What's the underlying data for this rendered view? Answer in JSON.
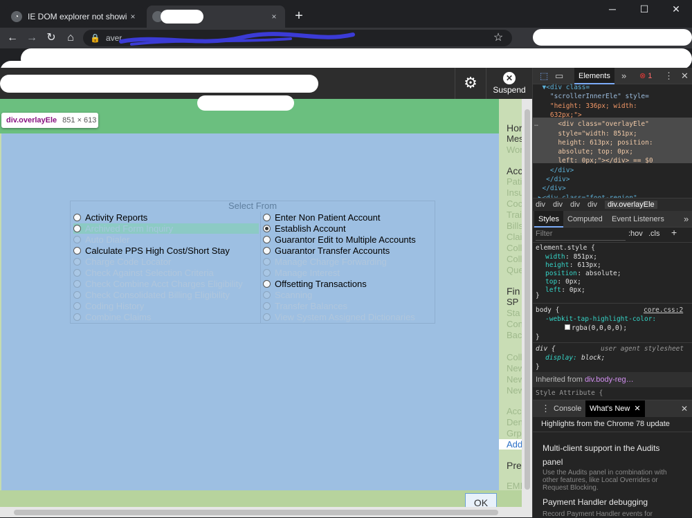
{
  "browser": {
    "tabs": [
      {
        "title": "IE DOM explorer not showing the",
        "close": "×"
      },
      {
        "title": "",
        "close": "×"
      }
    ],
    "new_tab": "+",
    "window_controls": [
      "─",
      "☐",
      "✕"
    ],
    "nav": {
      "back": "←",
      "forward": "→",
      "reload": "↻",
      "home": "⌂",
      "star": "☆"
    },
    "address": "aver..."
  },
  "app": {
    "settings_icon": "⚙",
    "suspend_label": "Suspend",
    "suspend_icon": "✕",
    "ok_label": "OK"
  },
  "inspect_tooltip": {
    "tag": "div.overlayEle",
    "dims": "851 × 613"
  },
  "select_from": {
    "title": "Select From",
    "left_options": [
      {
        "label": "Activity Reports",
        "state": "normal"
      },
      {
        "label": "Archived Form Inquiry",
        "state": "highlight"
      },
      {
        "label": "Auto Dialer",
        "state": "dim"
      },
      {
        "label": "Calculate PPS High Cost/Short Stay",
        "state": "normal"
      },
      {
        "label": "Charge Code Locator",
        "state": "dim"
      },
      {
        "label": "Check Against Selection Criteria",
        "state": "dim"
      },
      {
        "label": "Check Combine Acct Charges Eligibility",
        "state": "dim"
      },
      {
        "label": "Check Consolidated Billing Eligibility",
        "state": "dim"
      },
      {
        "label": "Coding History",
        "state": "dim"
      },
      {
        "label": "Combine Claims",
        "state": "dim"
      }
    ],
    "right_options": [
      {
        "label": "Enter Non Patient Account",
        "state": "normal"
      },
      {
        "label": "Establish Account",
        "state": "selected"
      },
      {
        "label": "Guarantor Edit to Multiple Accounts",
        "state": "normal"
      },
      {
        "label": "Guarantor Transfer Accounts",
        "state": "normal"
      },
      {
        "label": "Manage Charge Forwarding",
        "state": "dim"
      },
      {
        "label": "Manage Interest",
        "state": "dim"
      },
      {
        "label": "Offsetting Transactions",
        "state": "normal"
      },
      {
        "label": "Scanning",
        "state": "dim"
      },
      {
        "label": "Transfer Balances",
        "state": "dim"
      },
      {
        "label": "View System Assigned Dictionaries",
        "state": "dim"
      }
    ]
  },
  "right_panel": [
    "Hor",
    "Mes",
    "Wor",
    "Acc",
    "Pati",
    "Insu",
    "Coc",
    "Trai",
    "Bills",
    "Clai",
    "Coll",
    "Coll",
    "Que",
    "Fin",
    "SP",
    "Sta",
    "Con",
    "Bac",
    "Coll",
    "New",
    "New",
    "New",
    "Acc",
    "Den",
    "Grp",
    "Add",
    "Pref",
    "EMI"
  ],
  "devtools": {
    "tabs": {
      "inspect": "⬚",
      "device": "▭",
      "elements": "Elements",
      "more": "»",
      "errors": "1",
      "menu": "⋮",
      "close": "✕"
    },
    "code_lines": [
      {
        "text": "  ▼<div class=",
        "kind": "tag"
      },
      {
        "text": "    \"scrollerInnerEle\" style=",
        "kind": "attr"
      },
      {
        "text": "    \"height: 336px; width:",
        "kind": "val"
      },
      {
        "text": "    632px;\">",
        "kind": "val"
      },
      {
        "text": "      <div class=\"overlayEle\"",
        "kind": "hi"
      },
      {
        "text": "      style=\"width: 851px;",
        "kind": "hi"
      },
      {
        "text": "      height: 613px; position:",
        "kind": "hi"
      },
      {
        "text": "      absolute; top: 0px;",
        "kind": "hi"
      },
      {
        "text": "      left: 0px;\"></div> == $0",
        "kind": "hi"
      },
      {
        "text": "    </div>",
        "kind": "tag"
      },
      {
        "text": "   </div>",
        "kind": "tag"
      },
      {
        "text": "  </div>",
        "kind": "tag"
      },
      {
        "text": " ▶<div class=\"foot-region\"",
        "kind": "tag"
      }
    ],
    "breadcrumbs": [
      "div",
      "div",
      "div",
      "div",
      "div.overlayEle"
    ],
    "style_tabs": [
      "Styles",
      "Computed",
      "Event Listeners",
      "»"
    ],
    "filter_placeholder": "Filter",
    "filter_tools": [
      ":hov",
      ".cls",
      "+"
    ],
    "element_style": {
      "selector": "element.style {",
      "props": [
        {
          "name": "width",
          "value": "851px;"
        },
        {
          "name": "height",
          "value": "613px;"
        },
        {
          "name": "position",
          "value": "absolute;"
        },
        {
          "name": "top",
          "value": "0px;"
        },
        {
          "name": "left",
          "value": "0px;"
        }
      ]
    },
    "body_rule": {
      "selector": "body {",
      "source": "core.css:2",
      "prop": "-webkit-tap-highlight-color:",
      "value": "rgba(0,0,0,0);"
    },
    "div_rule": {
      "selector": "div {",
      "source": "user agent stylesheet",
      "prop": "display:",
      "value": "block;"
    },
    "inherited": {
      "label": "Inherited from",
      "from": "div.body-reg…"
    },
    "style_attribute": "Style Attribute {",
    "drawer_tabs": {
      "menu": "⋮",
      "console": "Console",
      "whatsnew": "What's New",
      "close": "✕"
    },
    "highlights": "Highlights from the Chrome 78 update",
    "news": [
      {
        "title": "Multi-client support in the Audits panel",
        "body": "Use the Audits panel in combination with other features, like Local Overrides or Request Blocking."
      },
      {
        "title": "Payment Handler debugging",
        "body": "Record Payment Handler events for"
      }
    ]
  },
  "colors": {
    "green_bar": "#6bbf7f",
    "overlay": "#9dbfe2",
    "devtools_bg": "#242424"
  }
}
